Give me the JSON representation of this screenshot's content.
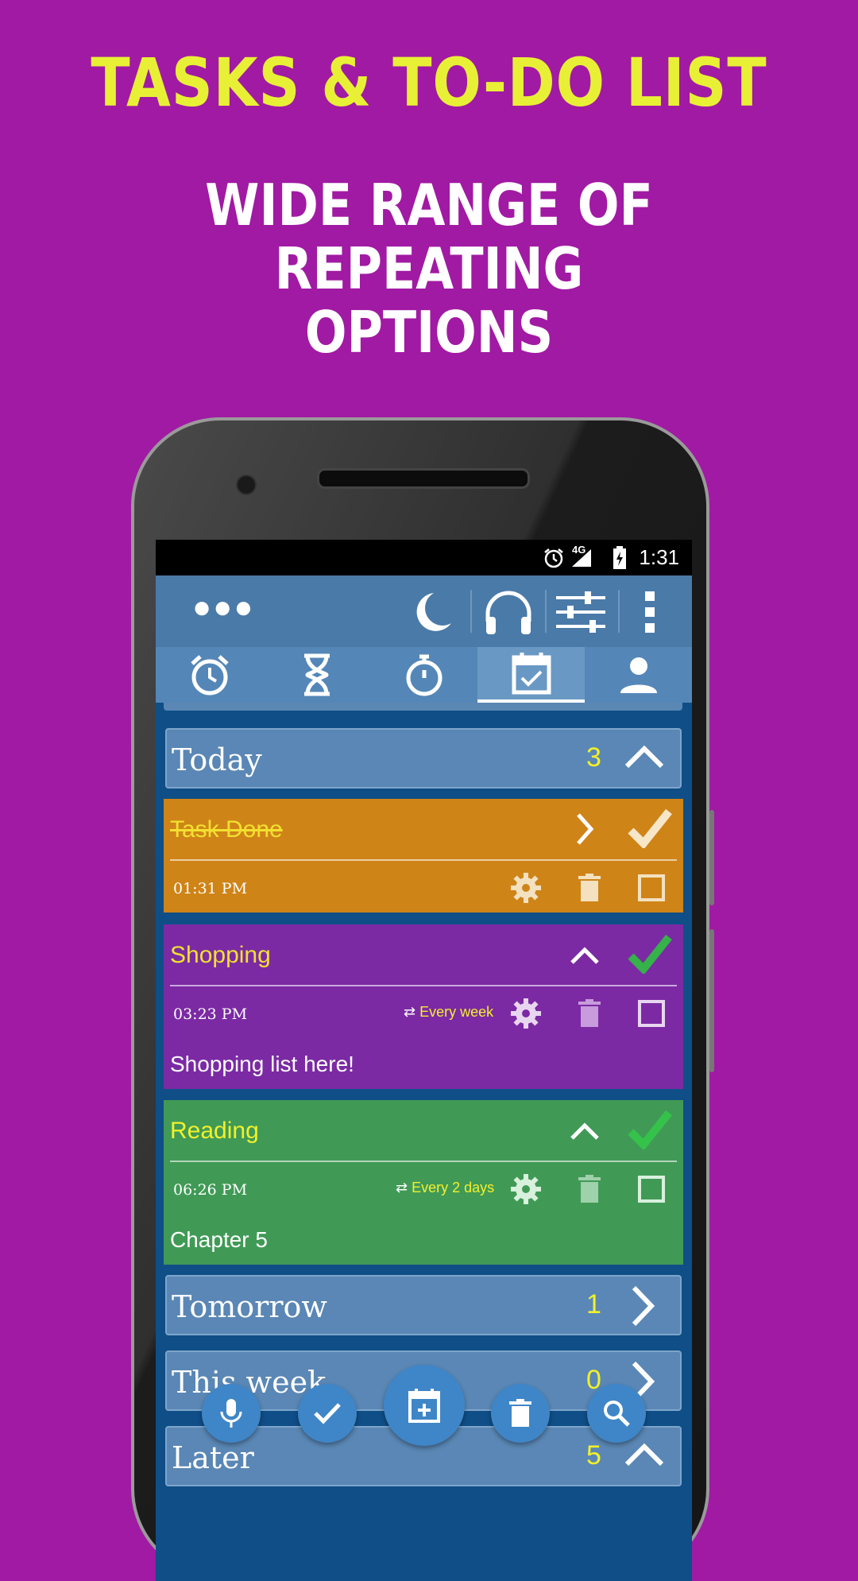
{
  "promo": {
    "headline": "TASKS & TO-DO LIST",
    "subline1": "WIDE RANGE OF",
    "subline2": "REPEATING",
    "subline3": "OPTIONS"
  },
  "statusbar": {
    "time": "1:31",
    "network": "4G"
  },
  "toolbar": {
    "icons": [
      "more-horizontal-icon",
      "night-mode-icon",
      "headphones-icon",
      "sliders-icon",
      "overflow-menu-icon"
    ]
  },
  "tabs": [
    {
      "name": "alarm",
      "icon": "alarm-clock-icon"
    },
    {
      "name": "timer",
      "icon": "hourglass-icon"
    },
    {
      "name": "stopwatch",
      "icon": "stopwatch-icon"
    },
    {
      "name": "tasks",
      "icon": "calendar-check-icon",
      "active": true
    },
    {
      "name": "profile",
      "icon": "person-icon"
    }
  ],
  "sections": {
    "today": {
      "label": "Today",
      "count": "3"
    },
    "tomorrow": {
      "label": "Tomorrow",
      "count": "1"
    },
    "this_week": {
      "label": "This week",
      "count": "0"
    },
    "later": {
      "label": "Later",
      "count": "5"
    }
  },
  "tasks": [
    {
      "title": "Task Done",
      "time": "01:31 PM",
      "repeat": "",
      "note": "",
      "color": "#cf8418",
      "done": true
    },
    {
      "title": "Shopping",
      "time": "03:23 PM",
      "repeat": "Every week",
      "note": "Shopping list here!",
      "color": "#7b2aa4",
      "done": false
    },
    {
      "title": "Reading",
      "time": "06:26 PM",
      "repeat": "Every 2 days",
      "note": "Chapter 5",
      "color": "#409a56",
      "done": false
    }
  ],
  "fabs": [
    "microphone-icon",
    "check-icon",
    "add-calendar-icon",
    "trash-icon",
    "search-icon"
  ],
  "colors": {
    "background": "#a11aa3",
    "headline": "#e8f036",
    "accent_yellow": "#f2f02a",
    "fab": "#3f86c8"
  }
}
